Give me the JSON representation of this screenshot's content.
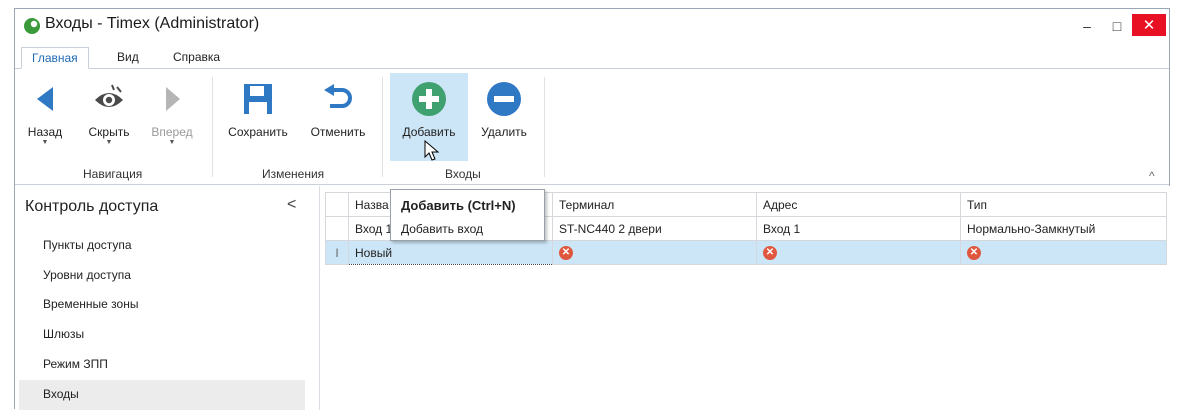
{
  "window": {
    "title": "Входы - Timex (Administrator)",
    "min_symbol": "–",
    "max_symbol": "□",
    "close_symbol": "✕"
  },
  "ribbon_tabs": [
    "Главная",
    "Вид",
    "Справка"
  ],
  "ribbon": {
    "groups": {
      "navigation": "Навигация",
      "changes": "Изменения",
      "inputs": "Входы"
    },
    "buttons": {
      "back": "Назад",
      "hide": "Скрыть",
      "forward": "Вперед",
      "save": "Сохранить",
      "cancel": "Отменить",
      "add": "Добавить",
      "delete": "Удалить"
    },
    "collapse_symbol": "^"
  },
  "sidebar": {
    "title": "Контроль доступа",
    "collapse_symbol": "<",
    "items": [
      "Пункты доступа",
      "Уровни доступа",
      "Временные зоны",
      "Шлюзы",
      "Режим ЗПП",
      "Входы"
    ],
    "selected": "Входы"
  },
  "grid": {
    "columns": [
      "Назва",
      "Терминал",
      "Адрес",
      "Тип"
    ],
    "rows": [
      {
        "indicator": "",
        "name": "Вход 1",
        "terminal": "ST-NC440 2 двери",
        "address": "Вход 1",
        "type": "Нормально-Замкнутый"
      },
      {
        "indicator": "I",
        "name": "Новый",
        "terminal": "",
        "address": "",
        "type": ""
      }
    ]
  },
  "tooltip": {
    "title": "Добавить (Ctrl+N)",
    "description": "Добавить вход"
  },
  "colors": {
    "accent": "#1f6bb5",
    "add_icon": "#3fa070",
    "delete_icon": "#2f78c4",
    "close_button": "#e81123",
    "selection": "#cde6f7",
    "error": "#e0573f"
  }
}
